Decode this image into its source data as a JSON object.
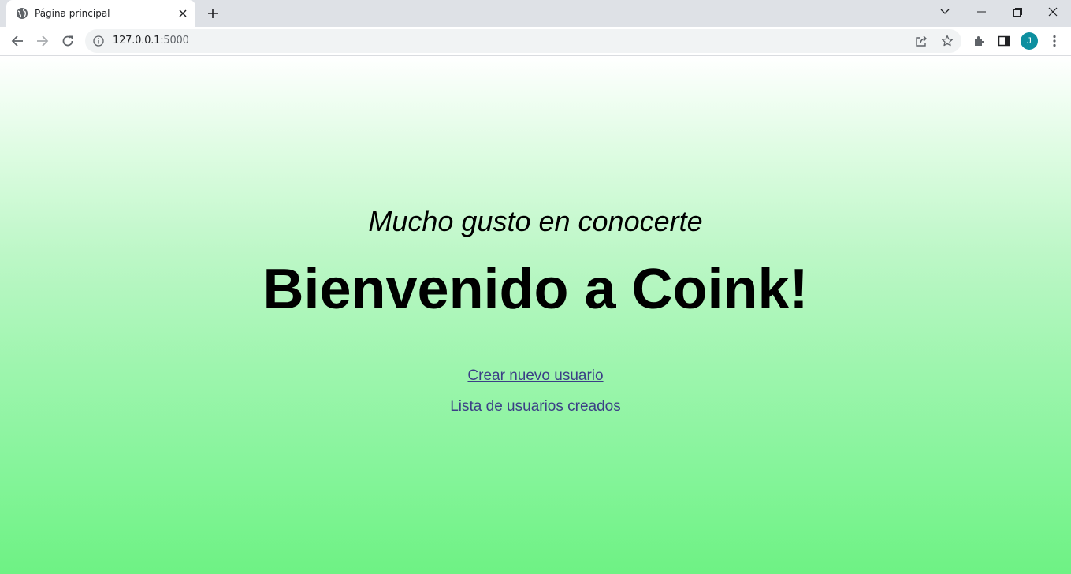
{
  "browser": {
    "tab": {
      "title": "Página principal"
    },
    "address_bar": {
      "host": "127.0.0.1",
      "port": ":5000"
    },
    "profile": {
      "initial": "J",
      "color": "#0d8f9f"
    }
  },
  "page": {
    "subtitle": "Mucho gusto en conocerte",
    "headline": "Bienvenido a Coink!",
    "links": [
      {
        "label": "Crear nuevo usuario"
      },
      {
        "label": "Lista de usuarios creados"
      }
    ],
    "gradient": {
      "top": "#ffffff",
      "bottom": "#6ef284"
    },
    "link_color": "#3b3f86"
  }
}
